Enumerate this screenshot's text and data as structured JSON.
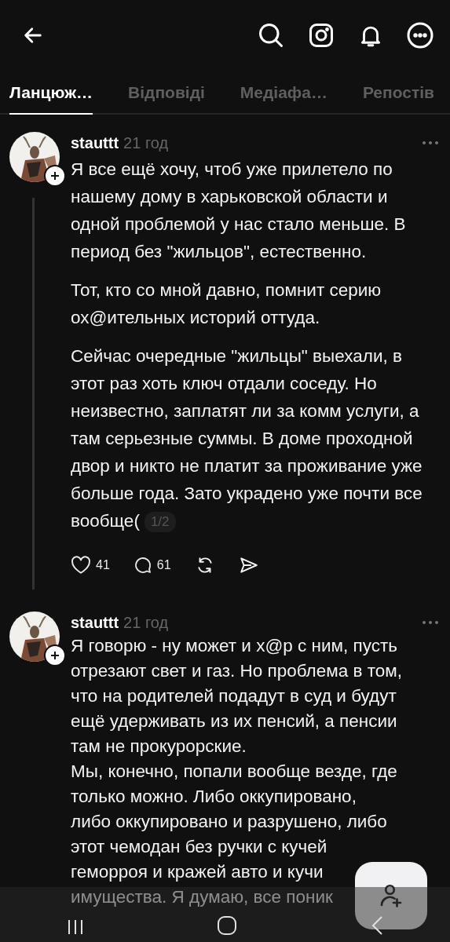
{
  "tabs": [
    {
      "label": "Ланцюж…",
      "selected": true
    },
    {
      "label": "Відповіді",
      "selected": false
    },
    {
      "label": "Медіафа…",
      "selected": false
    },
    {
      "label": "Репостів",
      "selected": false
    }
  ],
  "posts": [
    {
      "username": "stauttt",
      "time": "21 год",
      "thread_continues": true,
      "paragraphs": [
        "Я все ещё хочу, чтоб уже прилетело по нашему дому в харьковской области и одной проблемой у нас стало меньше. В период без \"жильцов\", естественно.",
        "Тот, кто со мной давно, помнит серию ох@ительных историй оттуда.",
        "Сейчас очередные \"жильцы\" выехали, в этот раз хоть ключ отдали соседу. Но неизвестно, заплатят ли за комм услуги, а там серьезные суммы. В доме проходной двор и никто не платит за проживание уже больше года. Зато украдено уже почти все вообще("
      ],
      "page_indicator": "1/2",
      "likes": "41",
      "replies": "61"
    },
    {
      "username": "stauttt",
      "time": "21 год",
      "thread_continues": false,
      "lines": [
        "Я говорю - ну может и х@р с ним, пусть",
        "отрезают свет и газ. Но проблема в том,",
        "что на родителей подадут в суд и будут",
        "ещё удерживать из их пенсий, а пенсии",
        "там не прокурорские.",
        "Мы, конечно, попали вообще везде, где",
        "только можно. Либо оккупировано,",
        "либо оккупировано и разрушено, либо",
        "этот чемодан без ручки с кучей",
        "геморроя и кражей авто и кучи",
        "имущества. Я думаю, все поник"
      ]
    }
  ]
}
